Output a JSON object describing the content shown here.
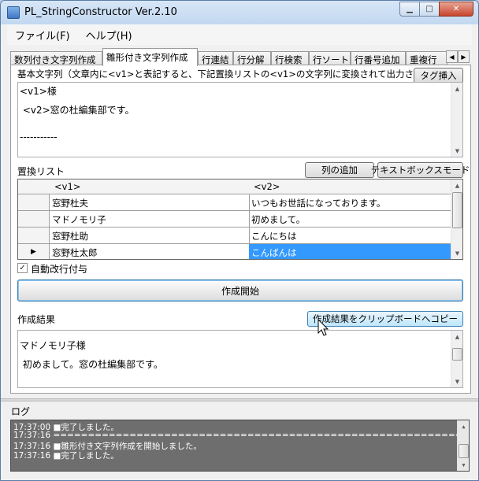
{
  "window": {
    "title": "PL_StringConstructor Ver.2.10"
  },
  "menu": [
    "ファイル(F)",
    "ヘルプ(H)"
  ],
  "tabs": [
    "数列付き文字列作成",
    "雛形付き文字列作成",
    "行連結",
    "行分解",
    "行検索",
    "行ソート",
    "行番号追加",
    "重複行"
  ],
  "base": {
    "label": "基本文字列（文章内に<v1>と表記すると、下記置換リストの<v1>の文字列に変換されて出力されます）",
    "tag_button": "タグ挿入",
    "lines": [
      "<v1>様",
      "",
      " <v2>窓の杜編集部です。",
      "",
      "",
      "-----------"
    ]
  },
  "replace": {
    "label": "置換リスト",
    "add_column_button": "列の追加",
    "textbox_mode_button": "テキストボックスモード",
    "columns": [
      "<v1>",
      "<v2>"
    ],
    "rows": [
      [
        "窓野杜夫",
        "いつもお世話になっております。"
      ],
      [
        "マドノモリ子",
        "初めまして。"
      ],
      [
        "窓野杜助",
        "こんにちは"
      ],
      [
        "窓野杜太郎",
        "こんばんは"
      ]
    ],
    "current_row_marker": "▶"
  },
  "auto_newline": {
    "label": "自動改行付与",
    "checked": true
  },
  "start_button": "作成開始",
  "result": {
    "label": "作成結果",
    "copy_button": "作成結果をクリップボードへコピー",
    "lines": [
      "マドノモリ子様",
      "",
      " 初めまして。窓の杜編集部です。"
    ]
  },
  "log": {
    "label": "ログ",
    "lines": [
      "17:37:00 ■完了しました。",
      "17:37:16 ================================================================",
      "17:37:16 ■雛形付き文字列作成を開始しました。",
      "17:37:16 ■完了しました。"
    ]
  }
}
